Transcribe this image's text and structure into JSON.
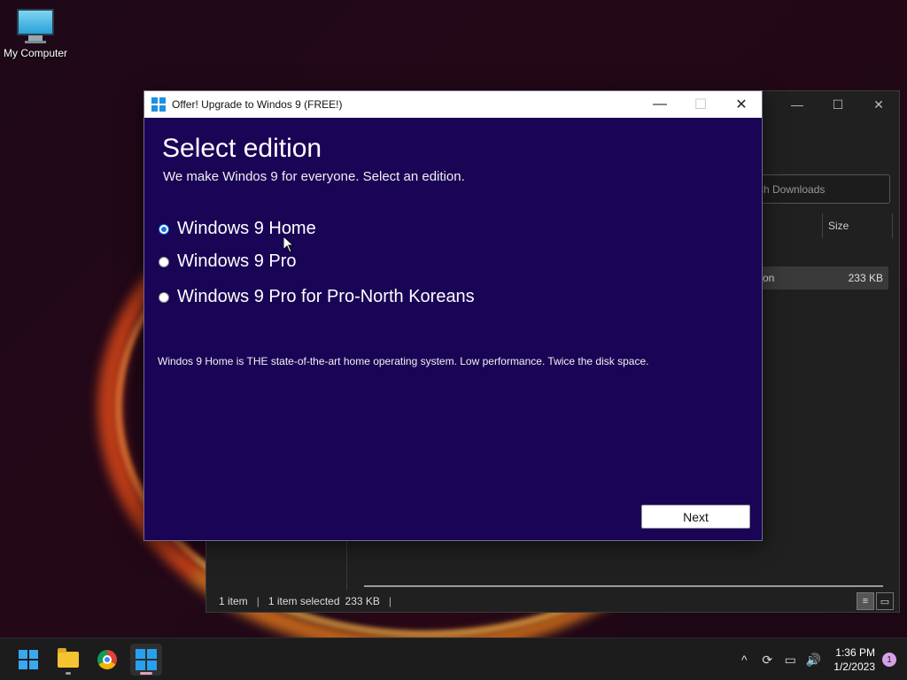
{
  "desktop": {
    "icons": [
      {
        "label": "My Computer",
        "icon": "computer-icon"
      }
    ]
  },
  "explorer": {
    "search_placeholder": "rch Downloads",
    "column_size": "Size",
    "row": {
      "name": "on",
      "size": "233 KB"
    },
    "status": {
      "items": "1 item",
      "selected": "1 item selected",
      "size": "233 KB"
    },
    "controls": {
      "minimize": "—",
      "maximize": "☐",
      "close": "✕"
    },
    "view_details_icon": "≡",
    "view_preview_icon": "▭"
  },
  "dialog": {
    "title": "Offer! Upgrade to Windos 9 (FREE!)",
    "controls": {
      "minimize": "—",
      "maximize": "☐",
      "close": "✕"
    },
    "heading": "Select edition",
    "subheading": "We make Windos 9 for everyone. Select an edition.",
    "options": [
      {
        "label": "Windows 9 Home",
        "checked": true
      },
      {
        "label": "Windows 9 Pro",
        "checked": false
      },
      {
        "label": "Windows 9 Pro for Pro-North Koreans",
        "checked": false
      }
    ],
    "description": "Windos 9 Home is THE state-of-the-art home operating system. Low performance. Twice the disk space.",
    "next_label": "Next"
  },
  "taskbar": {
    "apps": [
      {
        "name": "start",
        "icon": "windows-start-icon"
      },
      {
        "name": "file-explorer",
        "icon": "folder-icon"
      },
      {
        "name": "chrome",
        "icon": "chrome-icon"
      },
      {
        "name": "upgrade-app",
        "icon": "windows-logo-icon",
        "active": true
      }
    ],
    "tray": {
      "chevron": "^",
      "sync": "⟳",
      "network": "▭",
      "volume": "🔊"
    },
    "time": "1:36 PM",
    "date": "1/2/2023",
    "notification_count": "1"
  },
  "colors": {
    "dialog_bg": "#1a0456",
    "accent": "#1a6fe0"
  }
}
